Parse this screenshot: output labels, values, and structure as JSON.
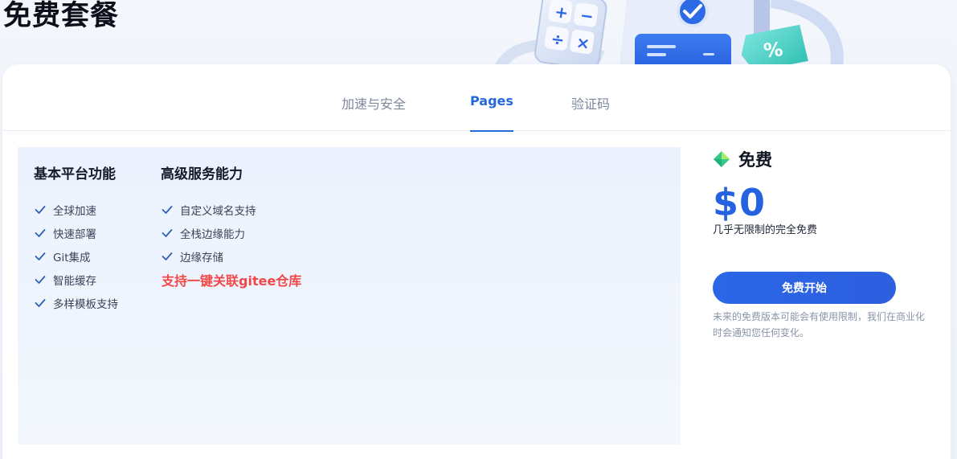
{
  "page": {
    "title": "免费套餐"
  },
  "tabs": [
    {
      "label": "加速与安全",
      "active": false
    },
    {
      "label": "Pages",
      "active": true
    },
    {
      "label": "验证码",
      "active": false
    }
  ],
  "features": {
    "basic": {
      "title": "基本平台功能",
      "items": [
        "全球加速",
        "快速部署",
        "Git集成",
        "智能缓存",
        "多样模板支持"
      ]
    },
    "advanced": {
      "title": "高级服务能力",
      "items": [
        "自定义域名支持",
        "全栈边缘能力",
        "边缘存储"
      ],
      "highlight": "支持一键关联gitee仓库"
    }
  },
  "pricing": {
    "plan_name": "免费",
    "price": "$0",
    "price_desc": "几乎无限制的完全免费",
    "cta_label": "免费开始",
    "note": "未来的免费版本可能会有使用限制，我们在商业化时会通知您任何变化。"
  },
  "colors": {
    "accent": "#2468e0",
    "highlight": "#f04848",
    "check": "#2f5fb8"
  },
  "icons": {
    "check": "check-icon",
    "diamond": "diamond-icon",
    "hero": "calculator-document-percent-illustration"
  }
}
